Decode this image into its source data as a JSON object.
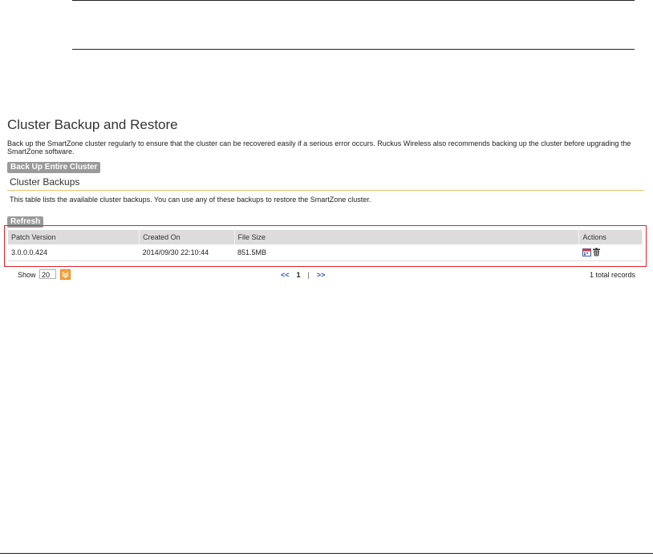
{
  "page": {
    "title": "Cluster Backup and Restore",
    "description": "Back up the SmartZone cluster regularly to ensure that the cluster can be recovered easily if a serious error occurs. Ruckus Wireless also recommends backing up the cluster before upgrading the SmartZone software.",
    "backup_button_label": "Back Up Entire Cluster"
  },
  "section": {
    "title": "Cluster Backups",
    "description": "This table lists the available cluster backups. You can use any of these backups to restore the SmartZone cluster.",
    "refresh_label": "Refresh"
  },
  "table": {
    "headers": [
      "Patch Version",
      "Created On",
      "File Size",
      "",
      "Actions"
    ],
    "rows": [
      {
        "patch_version": "3.0.0.0.424",
        "created_on": "2014/09/30 22:10:44",
        "file_size": "851.5MB",
        "actions": [
          "restore-icon",
          "delete-icon"
        ]
      }
    ]
  },
  "pager": {
    "show_label": "Show",
    "page_size": "20",
    "prev": "<<",
    "current": "1",
    "separator": "|",
    "next": ">>",
    "total": "1 total records"
  },
  "colors": {
    "highlight_border": "#e0242a",
    "button_gray": "#9a9a9a",
    "header_gray": "#dcdcdc",
    "section_rule": "#f0c070",
    "dropdown_orange": "#f6a640",
    "pager_link": "#3355bb"
  }
}
